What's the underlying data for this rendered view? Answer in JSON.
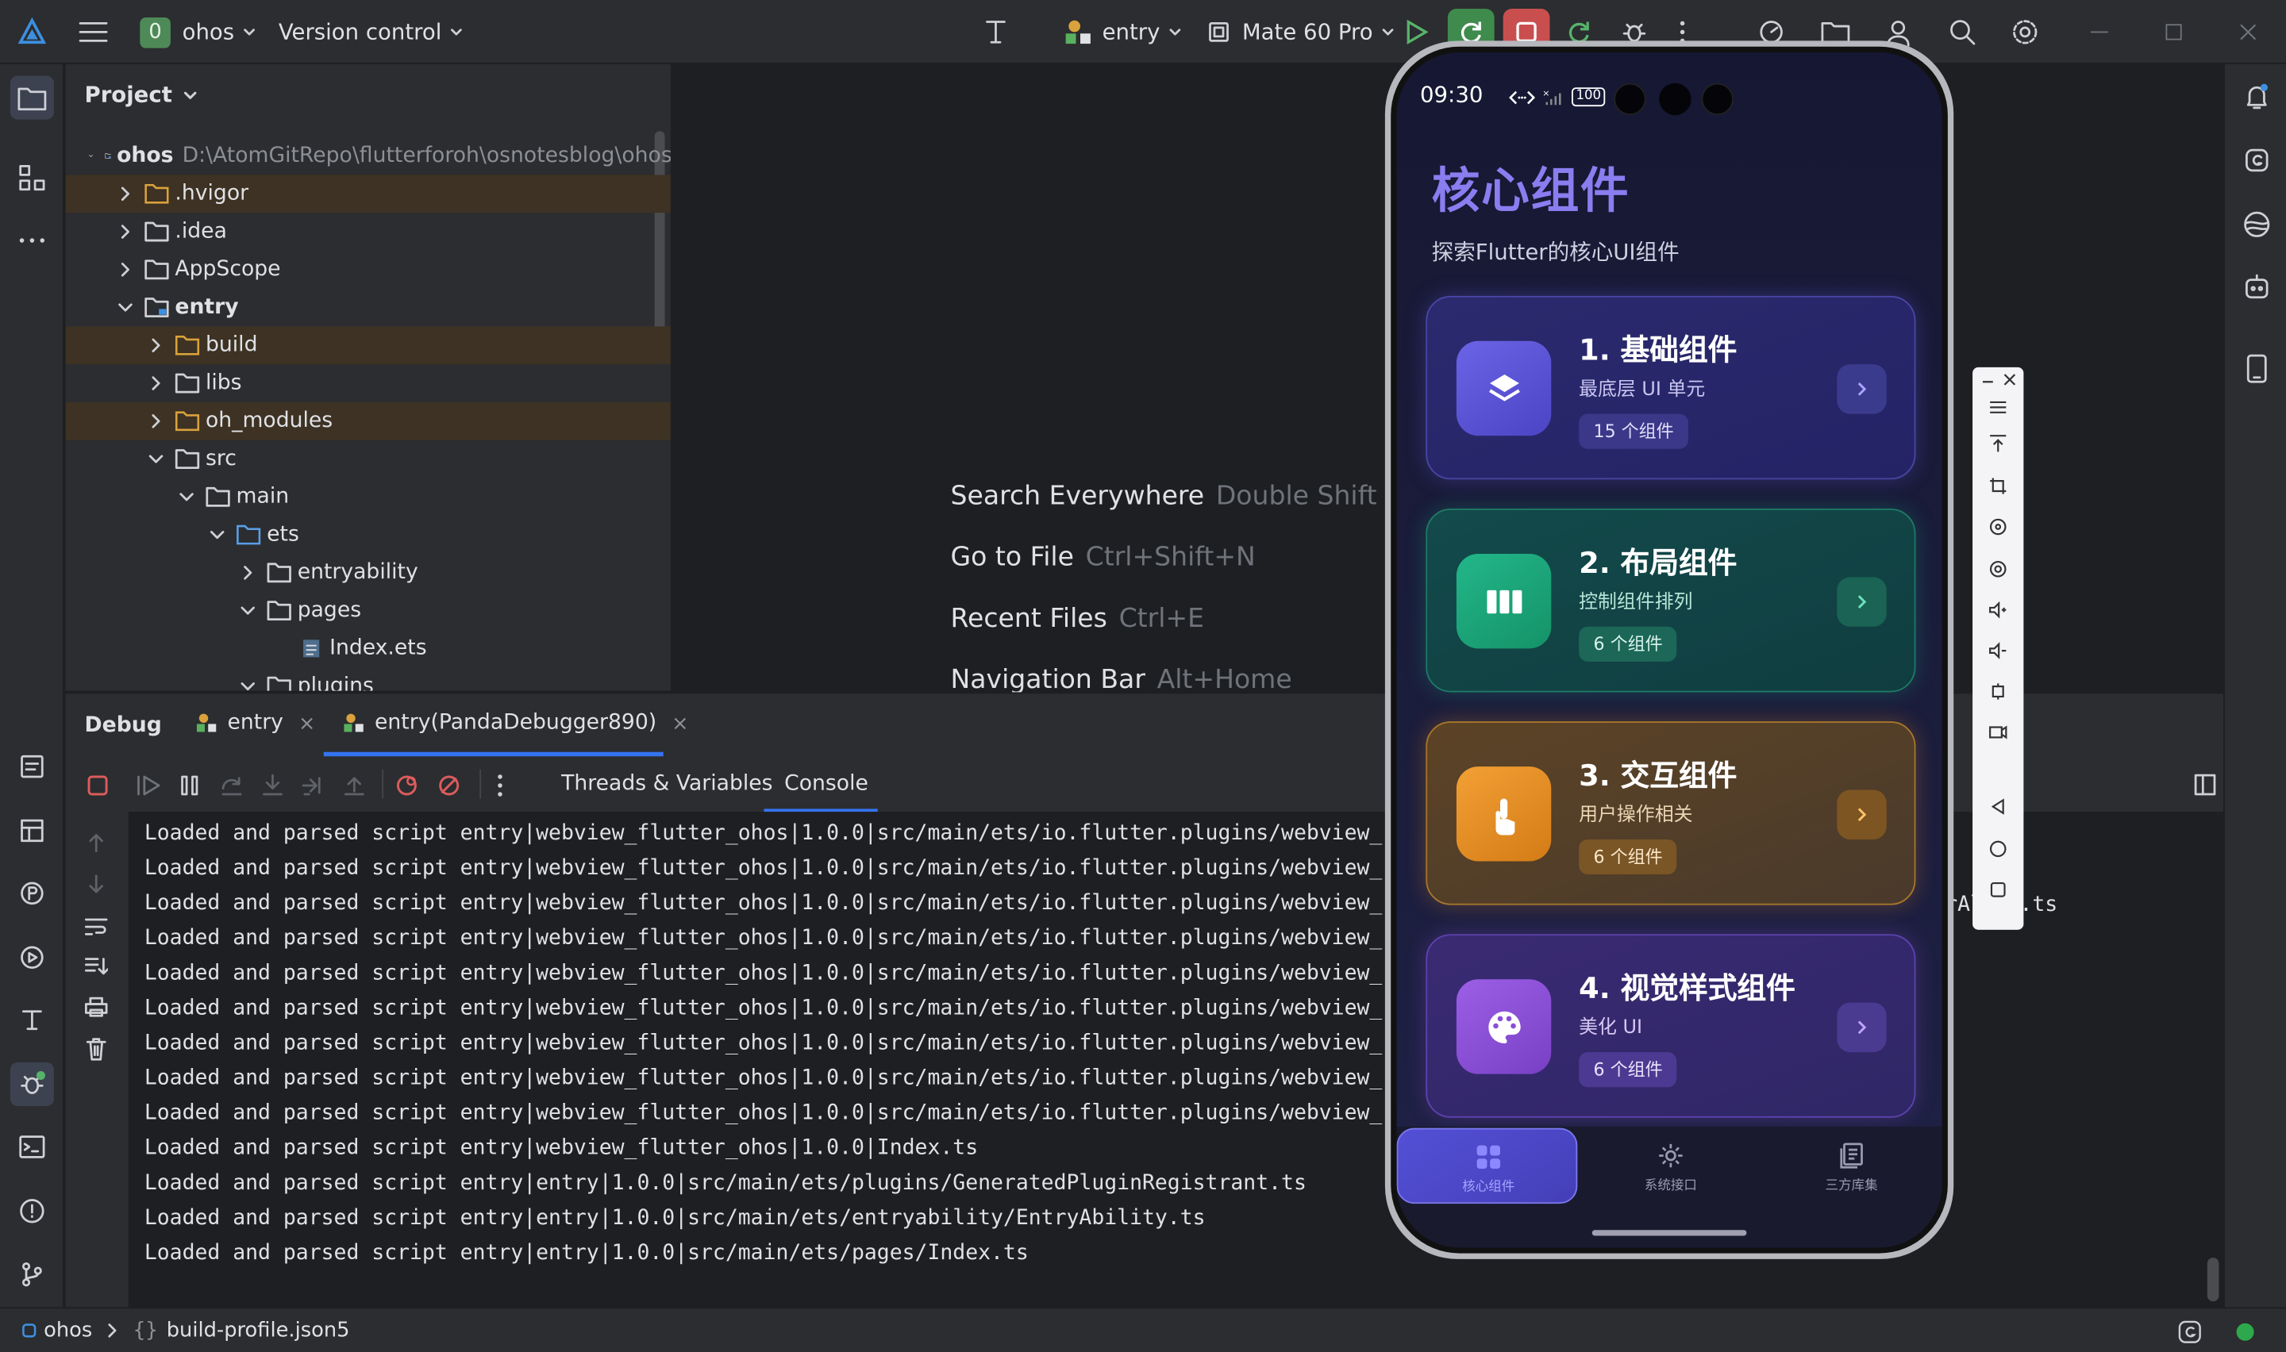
{
  "titlebar": {
    "project_badge": "0",
    "project_name": "ohos",
    "vcs": "Version control",
    "run_config": "entry",
    "device": "Mate 60 Pro"
  },
  "project_panel": {
    "title": "Project",
    "root_name": "ohos",
    "root_path": "D:\\AtomGitRepo\\flutterforoh\\osnotesblog\\ohos",
    "items": [
      ".hvigor",
      ".idea",
      "AppScope",
      "entry",
      "build",
      "libs",
      "oh_modules",
      "src",
      "main",
      "ets",
      "entryability",
      "pages",
      "Index.ets",
      "plugins"
    ]
  },
  "editor_hints": [
    {
      "label": "Search Everywhere",
      "key": "Double Shift"
    },
    {
      "label": "Go to File",
      "key": "Ctrl+Shift+N"
    },
    {
      "label": "Recent Files",
      "key": "Ctrl+E"
    },
    {
      "label": "Navigation Bar",
      "key": "Alt+Home"
    }
  ],
  "debug": {
    "title": "Debug",
    "tabs": [
      "entry",
      "entry(PandaDebugger890)"
    ],
    "subtabs": [
      "Threads & Variables",
      "Console"
    ]
  },
  "console_lines": [
    "Loaded and parsed script entry|webview_flutter_ohos|1.0.0|src/main/ets/io.flutter.plugins/webview_",
    "Loaded and parsed script entry|webview_flutter_ohos|1.0.0|src/main/ets/io.flutter.plugins/webview_",
    "Loaded and parsed script entry|webview_flutter_ohos|1.0.0|src/main/ets/io.flutter.plugins/webview_",
    "Loaded and parsed script entry|webview_flutter_ohos|1.0.0|src/main/ets/io.flutter.plugins/webview_",
    "Loaded and parsed script entry|webview_flutter_ohos|1.0.0|src/main/ets/io.flutter.plugins/webview_",
    "Loaded and parsed script entry|webview_flutter_ohos|1.0.0|src/main/ets/io.flutter.plugins/webview_",
    "Loaded and parsed script entry|webview_flutter_ohos|1.0.0|src/main/ets/io.flutter.plugins/webview_",
    "Loaded and parsed script entry|webview_flutter_ohos|1.0.0|src/main/ets/io.flutter.plugins/webview_",
    "Loaded and parsed script entry|webview_flutter_ohos|1.0.0|src/main/ets/io.flutter.plugins/webview_",
    "Loaded and parsed script entry|webview_flutter_ohos|1.0.0|Index.ts",
    "Loaded and parsed script entry|entry|1.0.0|src/main/ets/plugins/GeneratedPluginRegistrant.ts",
    "Loaded and parsed script entry|entry|1.0.0|src/main/ets/entryability/EntryAbility.ts",
    "Loaded and parsed script entry|entry|1.0.0|src/main/ets/pages/Index.ts"
  ],
  "console_overflow_text": "rAl",
  "console_overflow_text2": "pl.ts",
  "statusbar": {
    "crumb1": "ohos",
    "crumb2": "build-profile.json5"
  },
  "phone": {
    "time": "09:30",
    "battery": "100",
    "title": "核心组件",
    "subtitle": "探索Flutter的核心UI组件",
    "cards": [
      {
        "title": "1. 基础组件",
        "sub": "最底层 UI 单元",
        "badge": "15 个组件",
        "icon": "layers-icon",
        "color": "#5b56d6"
      },
      {
        "title": "2. 布局组件",
        "sub": "控制组件排列",
        "badge": "6 个组件",
        "icon": "columns-icon",
        "color": "#17a37a"
      },
      {
        "title": "3. 交互组件",
        "sub": "用户操作相关",
        "badge": "6 个组件",
        "icon": "touch-icon",
        "color": "#e08a1e"
      },
      {
        "title": "4. 视觉样式组件",
        "sub": "美化 UI",
        "badge": "6 个组件",
        "icon": "palette-icon",
        "color": "#8a4fd6"
      }
    ],
    "nav": [
      "核心组件",
      "系统接口",
      "三方库集"
    ]
  }
}
